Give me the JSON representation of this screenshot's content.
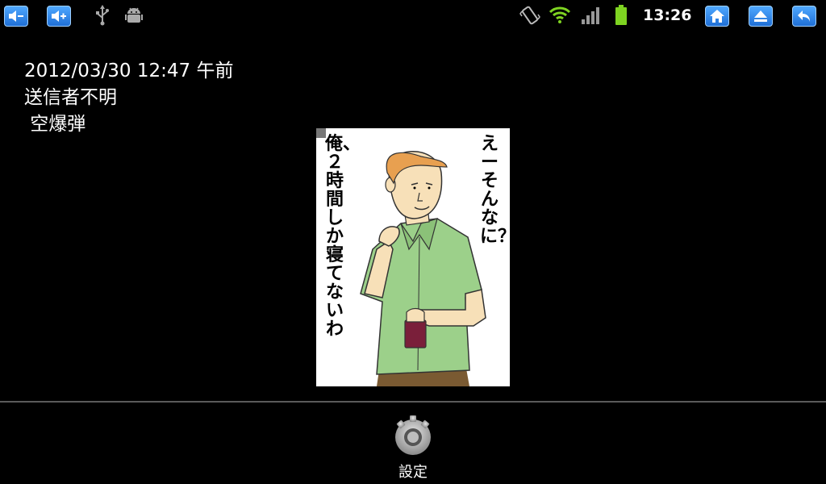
{
  "statusbar": {
    "left_icons": [
      "volume-down-icon",
      "volume-up-icon",
      "usb-icon",
      "android-debug-icon"
    ],
    "right_icons": [
      "vibrate-icon",
      "wifi-icon",
      "signal-icon",
      "battery-icon"
    ],
    "time": "13:26",
    "nav_buttons": [
      "home-icon",
      "menu-icon",
      "back-icon"
    ],
    "accent_color": "#2f86ee",
    "battery_color": "#7ed321"
  },
  "message": {
    "datetime": "2012/03/30 12:47 午前",
    "sender": "送信者不明",
    "subject": " 空爆弾"
  },
  "comic": {
    "caption_right": "えーそんなに？",
    "caption_left": "俺、２時間しか寝てないわ"
  },
  "footer": {
    "settings_label": "設定"
  }
}
